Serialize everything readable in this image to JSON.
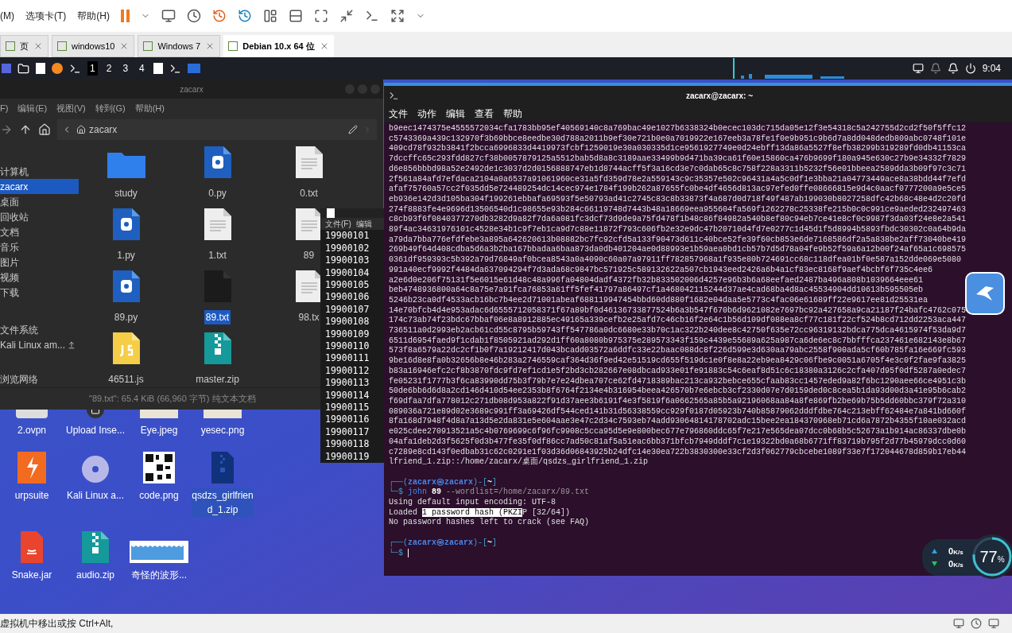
{
  "vm_menu": [
    "(M)",
    "选项卡(T)",
    "帮助(H)"
  ],
  "vm_tabs": [
    {
      "label": "页",
      "selected": false
    },
    {
      "label": "windows10",
      "selected": false
    },
    {
      "label": "Windows 7",
      "selected": false
    },
    {
      "label": "Debian 10.x 64 位",
      "selected": true
    }
  ],
  "panel": {
    "workspaces": [
      {
        "label": "1",
        "selected": true
      },
      {
        "label": "2",
        "selected": false
      },
      {
        "label": "3",
        "selected": false
      },
      {
        "label": "4",
        "selected": false
      }
    ],
    "time": "9:04"
  },
  "file_manager": {
    "title": "zacarx",
    "menu": [
      "F)",
      "编辑(E)",
      "视图(V)",
      "转到(G)",
      "帮助(H)"
    ],
    "path": "zacarx",
    "sidebar": [
      {
        "label": "计算机",
        "selected": false
      },
      {
        "label": "zacarx",
        "selected": true
      },
      {
        "label": "桌面",
        "selected": false
      },
      {
        "label": "回收站",
        "selected": false
      },
      {
        "label": "文档",
        "selected": false
      },
      {
        "label": "音乐",
        "selected": false
      },
      {
        "label": "图片",
        "selected": false
      },
      {
        "label": "视频",
        "selected": false
      },
      {
        "label": "下载",
        "selected": false
      },
      {
        "label": "文件系统",
        "selected": false
      },
      {
        "label": "Kali Linux am...",
        "selected": false
      },
      {
        "label": "浏览网络",
        "selected": false
      }
    ],
    "files": [
      {
        "name": "study",
        "kind": "folder",
        "selected": false
      },
      {
        "name": "0.py",
        "kind": "python",
        "selected": false
      },
      {
        "name": "0.txt",
        "kind": "text",
        "selected": false
      },
      {
        "name": "1.py",
        "kind": "python",
        "selected": false
      },
      {
        "name": "1.txt",
        "kind": "text",
        "selected": false
      },
      {
        "name": "89",
        "kind": "text",
        "selected": false
      },
      {
        "name": "89.py",
        "kind": "python",
        "selected": false
      },
      {
        "name": "89.txt",
        "kind": "dark",
        "selected": true
      },
      {
        "name": "98.tx",
        "kind": "text",
        "selected": false
      },
      {
        "name": "46511.js",
        "kind": "js",
        "selected": false
      },
      {
        "name": "master.zip",
        "kind": "zip",
        "selected": false
      }
    ],
    "status": "\"89.txt\": 65.4 KiB (66,960 字节) 纯文本文档"
  },
  "editor": {
    "menu": [
      "文件(F)",
      "编辑"
    ],
    "lines": [
      "19900101",
      "19900102",
      "19900103",
      "19900104",
      "19900105",
      "19900106",
      "19900107",
      "19900108",
      "19900109",
      "19900110",
      "19900111",
      "19900112",
      "19900113",
      "19900114",
      "19900115",
      "19900116",
      "19900117",
      "19900118",
      "19900119"
    ]
  },
  "terminal": {
    "title": "zacarx@zacarx: ~",
    "menu": [
      "文件",
      "动作",
      "编辑",
      "查看",
      "帮助"
    ],
    "output": [
      "b9eec1474375e4555572034cfa1783bb95ef40569140c8a769bac49e1027b6338324b0ecec103dc715da05e12f3e54318c5a242755d2cd2f50f5ffc12",
      "c5743369a439c132970f3b69bbce8eedbe30d788a2011b9ef30e721b0e0a7019922e167eeb3a78fe1f0e9b951c9b6d7a8dd048dedb809abc0748f101e",
      "409cd78f932b3841f2bcca6996833d4419973fcbf1259019e30a030335d1ce9561927749e0d24ebff13da86a5527f8efb38299b319289fd0db41153ca",
      "7dccffc65c293fdd827cf38b0057879125a5512bab5d8a8c3189aae33499b9d471ba39ca61f60e15860ca476b9699f180a945e630c27b9e34332f7829",
      "d6e856bbbd98a52e2492de1c3037d2d0156888747eb1d8744acff5f3a16cd3e7c0dab65c8c758f228a3311b5232f56e01bbeea2589dda3b09f97c3c71",
      "2f561a84afd7efdaca2104a0a6537a91061960ce31a5fd359d78e2a559143c9c35357e502c96431a4a5c0df1e3bba21a04773449ace8a38bdd44f7efd",
      "afaf75760a57cc2f035dd5e724489254dc14cec974e1784f199b262a87655fc0be4df4656d813ac97efed0ffe08666815e9d4c0aacf0777200a9e5ce5",
      "eb936e142d3d105ba304f199261ebbafa69593f5e50793ad41c2745c83c8b33873f4a687d0d718f49f487ab199030b8027258dfc42b68c48e4d2c20fd",
      "274f8883fe4e9696d13506540d1c98655e93b284c66119748d7443b48a18669eea955604fa569f1262278c25338fe215b0c0c991ce9aeded232497463",
      "c8cb93f6f0840377270db3282d9a82f7da6a081fc3dcf73d9de9a75fd478f1b48c86f84982a540b8ef80c94eb7ce41e8cf0c9987f3da03f24e8e2a541",
      "89f4ac34631976101c4528e34b1c9f7eb1ca9d7c88e11872f793c606fb2e32e9dc47b20710d4fd7e0277c1d45d1f5d8994b5893fbdc30302c0a64b9da",
      "a79da7bba776efdfebe3a895a642620613b08882bc7fc92cfd5a133f90473d611c40bce52fe39f60cb853e6de7168586df2a5a838be2aff73040be419",
      "269b49f64d408cdba5d6a3b2ba167bbadaa6baa873da0db401204ae0d88993e1b59aea0bd1cb57b7d5d78a04fe9b52f59a6a12b00f24af65a1c698575",
      "0361df959393c5b392a79d76849af0bcea8543a0a4090c60a07a97911ff782857968a1f935e80b724691cc68c118dfea01bf0e587a152dde069e5080",
      "991a40ecf9992f4484da637094294f7d3ada68c9847bc571925c589132622a507cb1943eed2426a6b4a1cf83ec8168f9aef4bcbf6f735c4ee6",
      "a2e6d0e206f75131f5e6015e61d48c48a996fa04804dadf4372fb32b833502006d4257e96b3b6a68eefaed2487ba496a808b1039664eee61",
      "beb4748936800a64c8a75e7a91fca76853a61ff5fef41797a86497cf1a468042115244d37ae4cad68ba4d8ac45534904dd10613b595505eb",
      "5246b23ca0df4533acb16bc7b4ee2d71001abeaf688119947454bbd60dd880f1682e04daa5e5773c4fac06e61689ff22e9617ee81d25531ea",
      "14e70bfcb4d4e953adac6d6555712058371f67a89bf0d46136733877524b6a3b547f670b6d9621082e7697bc92a427658a9ca21187f24bafc4762c075",
      "174c73ab74f23bdc67bbaf06e8a8912885ec49165a339cefb2e25afd7c46cb16f2e64c1b56d109df088ea8cf77c181f22cf524b8cd712dd2253aca447",
      "736511a0d2993eb2acb61cd55c8795b59743ff547786a0dc6680e33b70c1ac322b240dee8c42750f635e72cc96319132bdca775dca4615974f53da9d7",
      "6511d6954faed9f1cdab1f8505921ad292d1ff60a8080b975375e289573343f159c4439e55689a625a987ca6de6ec8c7bbfffca237461e682143e8b67",
      "573f8a6579a22dc2cf1b0f7a19212417d043bcadd03572a6ddfc33e22baac088dc8f226d599e3d630aa79abc2558f900ada5cf60b785fa16e669fc593",
      "9be16d8e8fa0b32656b8e46b283a2746559caf364d36f9ed42e51519cd655f519dc1e0f8e8a22eb9ea8429c06fbe9c0051a6705f4e3c0f2fae9fa3825",
      "b83a16946efc2cf8b3870fdc9fd7ef1cd1e5f2bd3cb282667e08dbcad933e01fe91883c54c6eaf8d51c6c18380a3126c2cfa407d95f0df5287a0edec7",
      "fe05231f1777b3f6ca83990dd75b3f79b7e7e24dbea707ce62fd4718389bac213ca932bebce655cfaab83cc1457eded9a82f6bc1290aee66ce4951c3b",
      "50de6bb6d6d8a2cd146d410d54ee2353b8f6764f2134e4b316954beea426570b7e6ebcb3cf2330d07e7d0159ded0c8cea5b1da93d00d3a41e95b6cab2",
      "f69dfaa7dfa778012c271db08d953a822f91d37aee3b6191f4e3f5819f6a0662565a85b5a92196068aa84a8fe869fb2be69b75b5dd60bbc379f72a310",
      "089036a721e89d02e3689c991ff3a69426df544ced141b31d56338559cc929f0187d05923b740b85879062dddfdbe764c213ebff62484e7a841bd660f",
      "8fa168d7948f4d8a7a13d5e2da831e5e604aae3e47c2d34c7593eb74add93064814178702adc15bee2ea184370968eb71cd6a7872b4355f10ae032acd",
      "e025cdee270913521a5c4b0769699c6f96fc9908c5cca95d5e9e800bec677e796860ddc65f7e217e565dea07dcc0b68b5c52673a1b914ac86337dbe0b",
      "04afa1deb2d3f5625f0d3b477fe35f0df86cc7ad50c81af5a51eac6bb371bfcb7949dddf7c1e19322bd0a68b6771ff83719b795f2d77b45979dcc0d60",
      "c7289e8cd143f0edbab31c62c0291e1f03d36d06843925b24dfc14e30ea722b3830300e33cf2d3f062779cbcebe1089f33e7f172044678d859b17eb44",
      "lfriend_1.zip::/home/zacarx/桌面/qsdzs_girlfriend_1.zip"
    ],
    "prompts": [
      {
        "open": "┌──(",
        "user": "zacarx",
        "at": "㉿",
        "host": "zacarx",
        "mid": ")-[",
        "dir": "~",
        "close": "]",
        "lead": "└─$"
      },
      {
        "open": "┌──(",
        "user": "zacarx",
        "at": "㉿",
        "host": "zacarx",
        "mid": ")-[",
        "dir": "~",
        "close": "]",
        "lead": "└─$"
      }
    ],
    "command": {
      "program": "john",
      "target": "89",
      "option": "--wordlist=/home/zacarx/89.txt"
    },
    "result": [
      {
        "before": "Using default input encoding: UTF-8"
      },
      {
        "before": "Loaded ",
        "highlight": "1 password hash (PKZI",
        "after": "P [32/64])"
      },
      {
        "before": "No password hashes left to crack (see FAQ)"
      }
    ]
  },
  "desktop": [
    {
      "name": "2.ovpn",
      "kind": "doc",
      "selected": false
    },
    {
      "name": "Upload Inse...",
      "kind": "upload",
      "selected": false
    },
    {
      "name": "Eye.jpeg",
      "kind": "photo",
      "selected": false
    },
    {
      "name": "yesec.png",
      "kind": "photo",
      "selected": false
    },
    {
      "name": "urpsuite",
      "kind": "burp",
      "selected": false
    },
    {
      "name": "Kali Linux a...",
      "kind": "disc",
      "selected": false
    },
    {
      "name": "code.png",
      "kind": "qr",
      "selected": false
    },
    {
      "name": "qsdzs_girlfriend_1.zip",
      "kind": "darkzip",
      "selected": true
    },
    {
      "name": "Snake.jar",
      "kind": "java",
      "selected": false
    },
    {
      "name": "audio.zip",
      "kind": "zip",
      "selected": false
    },
    {
      "name": "奇怪的波形...",
      "kind": "wave",
      "selected": false
    }
  ],
  "net": {
    "up": "0",
    "down": "0",
    "unit": "K/s",
    "unit_down": "K/s",
    "percent": "77",
    "sign": "%"
  },
  "vm_status": "虚拟机中移出或按 Ctrl+Alt,"
}
